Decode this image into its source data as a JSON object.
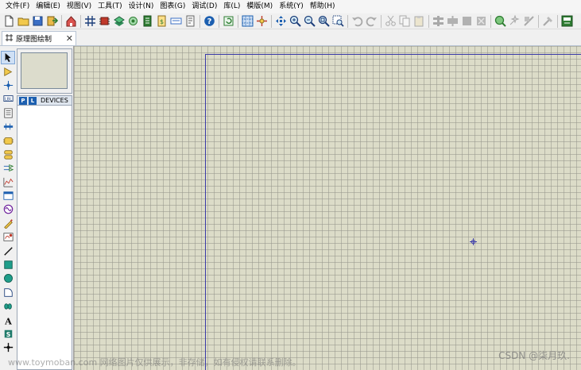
{
  "menu": {
    "items": [
      {
        "label": "文件(F)"
      },
      {
        "label": "编辑(E)"
      },
      {
        "label": "视图(V)"
      },
      {
        "label": "工具(T)"
      },
      {
        "label": "设计(N)"
      },
      {
        "label": "图表(G)"
      },
      {
        "label": "调试(D)"
      },
      {
        "label": "库(L)"
      },
      {
        "label": "模版(M)"
      },
      {
        "label": "系统(Y)"
      },
      {
        "label": "帮助(H)"
      }
    ]
  },
  "toolbar": {
    "buttons": [
      {
        "icon": "new-file-icon"
      },
      {
        "icon": "open-folder-icon"
      },
      {
        "icon": "save-icon"
      },
      {
        "icon": "import-icon"
      },
      {
        "icon": "home-icon"
      },
      {
        "icon": "schematic-icon"
      },
      {
        "icon": "chip-icon"
      },
      {
        "icon": "3d-view-icon"
      },
      {
        "icon": "gerber-icon"
      },
      {
        "icon": "bom-icon"
      },
      {
        "icon": "notes-icon"
      },
      {
        "icon": "bill-icon"
      },
      {
        "icon": "project-notes-icon"
      },
      {
        "icon": "help-icon"
      },
      {
        "icon": "refresh-icon"
      },
      {
        "icon": "grid-icon"
      },
      {
        "icon": "origin-icon"
      },
      {
        "icon": "pan-icon"
      },
      {
        "icon": "zoom-in-icon"
      },
      {
        "icon": "zoom-out-icon"
      },
      {
        "icon": "zoom-all-icon"
      },
      {
        "icon": "zoom-area-icon"
      },
      {
        "icon": "undo-icon"
      },
      {
        "icon": "redo-icon"
      },
      {
        "icon": "cut-icon"
      },
      {
        "icon": "copy-icon"
      },
      {
        "icon": "paste-icon"
      },
      {
        "icon": "block-copy-icon"
      },
      {
        "icon": "block-move-icon"
      },
      {
        "icon": "block-rotate-icon"
      },
      {
        "icon": "block-delete-icon"
      },
      {
        "icon": "pick-device-icon"
      },
      {
        "icon": "make-device-icon"
      },
      {
        "icon": "packaging-icon"
      },
      {
        "icon": "decompose-icon"
      },
      {
        "icon": "wire-autorouter-icon"
      }
    ]
  },
  "tab": {
    "label": "原理图绘制",
    "close_icon": "close-icon"
  },
  "toolstrip": {
    "tools": [
      {
        "icon": "selection-mode-icon",
        "active": true
      },
      {
        "icon": "component-mode-icon"
      },
      {
        "icon": "junction-dot-icon"
      },
      {
        "icon": "wire-label-icon"
      },
      {
        "icon": "text-script-icon"
      },
      {
        "icon": "buses-icon"
      },
      {
        "icon": "subcircuit-icon"
      },
      {
        "icon": "terminals-icon"
      },
      {
        "icon": "device-pins-icon"
      },
      {
        "icon": "graph-icon"
      },
      {
        "icon": "tape-recorder-icon"
      },
      {
        "icon": "generator-icon"
      },
      {
        "icon": "voltage-probe-icon"
      },
      {
        "icon": "virtual-instruments-icon"
      },
      {
        "icon": "line-icon"
      },
      {
        "icon": "box-icon"
      },
      {
        "icon": "circle-icon"
      },
      {
        "icon": "arc-icon"
      },
      {
        "icon": "closed-path-icon"
      },
      {
        "icon": "text-icon"
      },
      {
        "icon": "symbol-icon"
      },
      {
        "icon": "marker-icon"
      }
    ]
  },
  "devices": {
    "pick_label": "P",
    "library_label": "L",
    "title": "DEVICES"
  },
  "watermark": {
    "left": "www.toymoban.com 网络图片仅供展示，非存储，如有侵权请联系删除。",
    "right": "CSDN @柒月玖."
  },
  "colors": {
    "canvas": "#dcdcc8",
    "sheet_border": "#3a3aa8",
    "accent": "#1c5fb0"
  }
}
